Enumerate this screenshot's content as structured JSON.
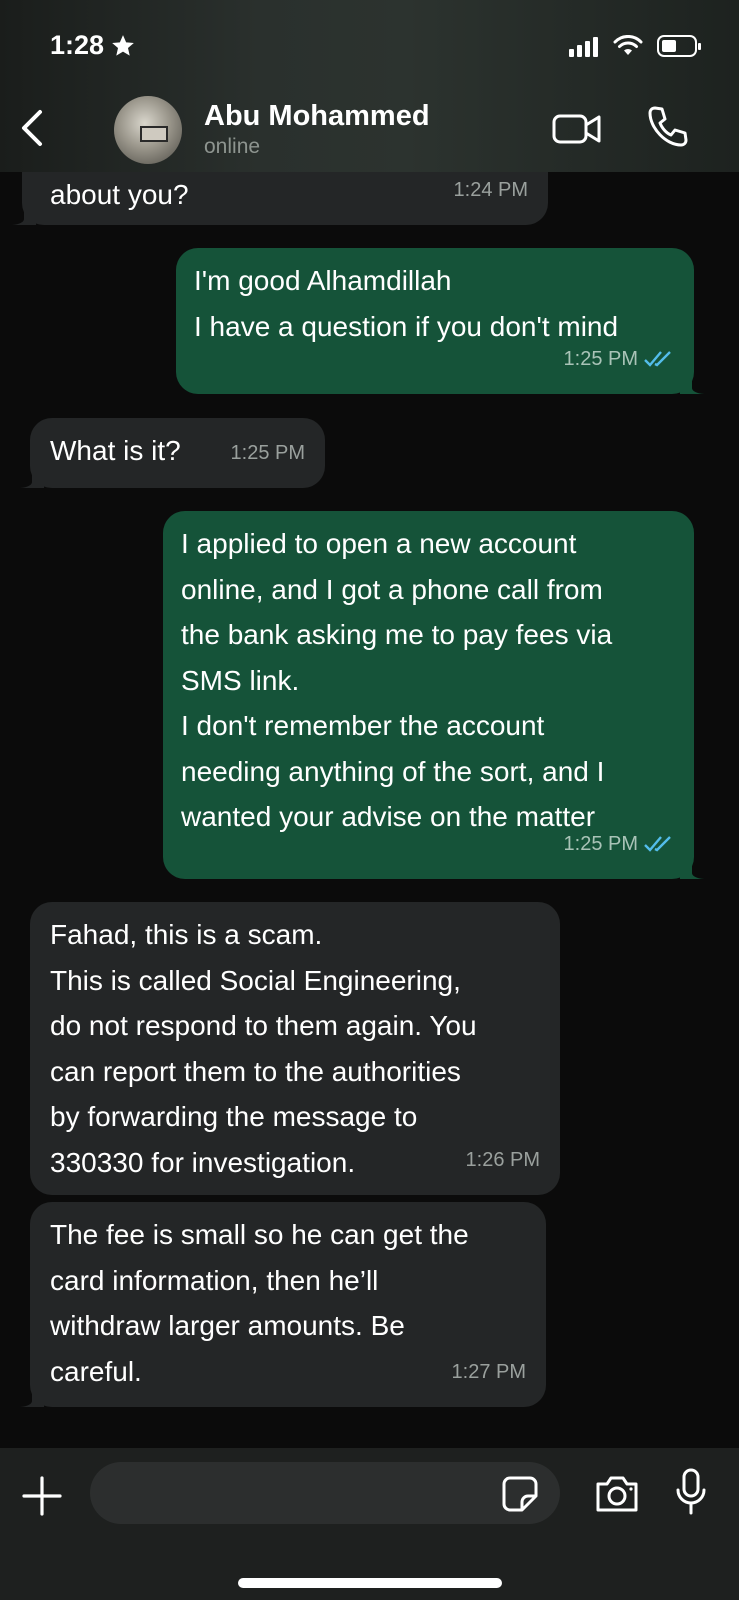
{
  "status_bar": {
    "time": "1:28"
  },
  "header": {
    "back_icon": "chevron-left-icon",
    "contact_name": "Abu Mohammed",
    "contact_status": "online",
    "video_icon": "video-camera-icon",
    "call_icon": "phone-icon"
  },
  "messages": [
    {
      "direction": "incoming",
      "text": "about you?",
      "time": "1:24 PM"
    },
    {
      "direction": "outgoing",
      "text": "I'm good Alhamdillah\nI have a question if you don't mind",
      "time": "1:25 PM",
      "status": "read"
    },
    {
      "direction": "incoming",
      "text": "What is it?",
      "time": "1:25 PM"
    },
    {
      "direction": "outgoing",
      "text": "I applied to open a new account\nonline, and I got a phone call from\nthe bank asking me to pay fees via\nSMS link.\nI don't remember the account\nneeding anything of the sort, and I\nwanted your advise on the matter",
      "time": "1:25 PM",
      "status": "read"
    },
    {
      "direction": "incoming",
      "text": "Fahad, this is a scam.\nThis is called Social Engineering,\ndo not respond to them again. You\ncan report them to the authorities\nby forwarding the message to\n330330 for investigation.",
      "time": "1:26 PM"
    },
    {
      "direction": "incoming",
      "text": "The fee is small so he can get the\ncard information, then he’ll\nwithdraw larger amounts. Be\ncareful.",
      "time": "1:27 PM"
    }
  ],
  "composer": {
    "placeholder": "",
    "plus_icon": "plus-icon",
    "sticker_icon": "sticker-icon",
    "camera_icon": "camera-icon",
    "mic_icon": "microphone-icon"
  },
  "colors": {
    "incoming_bubble": "#242627",
    "outgoing_bubble": "#155339",
    "read_receipt": "#53bdeb",
    "background": "#0b0b0b"
  }
}
